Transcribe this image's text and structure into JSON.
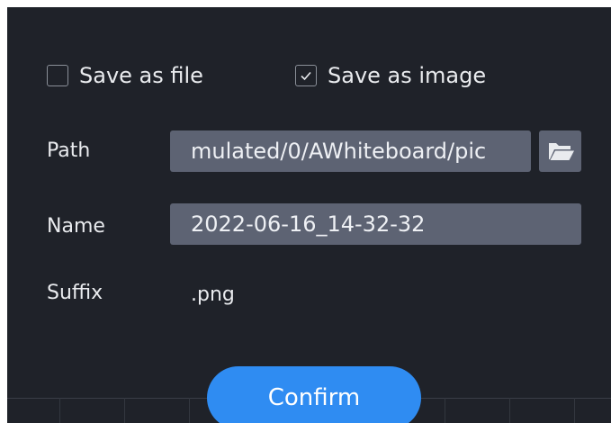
{
  "options": {
    "save_as_file": {
      "label": "Save as file",
      "checked": false
    },
    "save_as_image": {
      "label": "Save as image",
      "checked": true
    }
  },
  "path": {
    "label": "Path",
    "value": "mulated/0/AWhiteboard/pic"
  },
  "name": {
    "label": "Name",
    "value": "2022-06-16_14-32-32"
  },
  "suffix": {
    "label": "Suffix",
    "value": ".png"
  },
  "confirm_label": "Confirm",
  "icons": {
    "folder": "folder-open-icon",
    "check": "check-icon"
  },
  "colors": {
    "background": "#1f2229",
    "field": "#5d6373",
    "accent": "#2f8cf2",
    "text": "#e9ebee"
  }
}
